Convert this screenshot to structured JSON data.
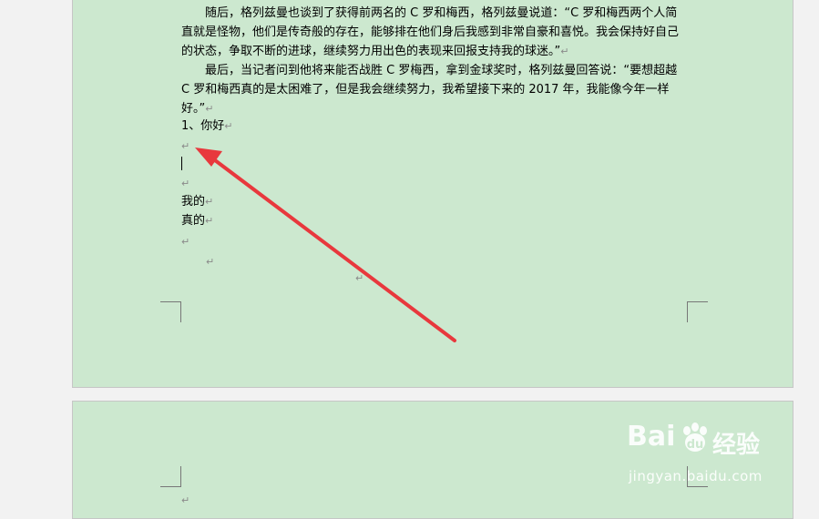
{
  "document": {
    "paragraph1": "随后，格列兹曼也谈到了获得前两名的 C 罗和梅西，格列兹曼说道：“C 罗和梅西两个人简直就是怪物，他们是传奇般的存在，能够排在他们身后我感到非常自豪和喜悦。我会保持好自己的状态，争取不断的进球，继续努力用出色的表现来回报支持我的球迷。”",
    "paragraph2": "最后，当记者问到他将来能否战胜 C 罗梅西，拿到金球奖时，格列兹曼回答说：“要想超越 C 罗和梅西真的是太困难了，但是我会继续努力，我希望接下来的 2017 年，我能像今年一样好。”",
    "list_item": "1、你好",
    "line_wode": "我的",
    "line_zhende": "真的",
    "paragraph_mark": "↵"
  },
  "watermark": {
    "brand_left": "Bai",
    "brand_right": "经验",
    "url": "jingyan.baidu.com"
  },
  "colors": {
    "page_background": "#cce8cf",
    "arrow": "#e8383d"
  }
}
